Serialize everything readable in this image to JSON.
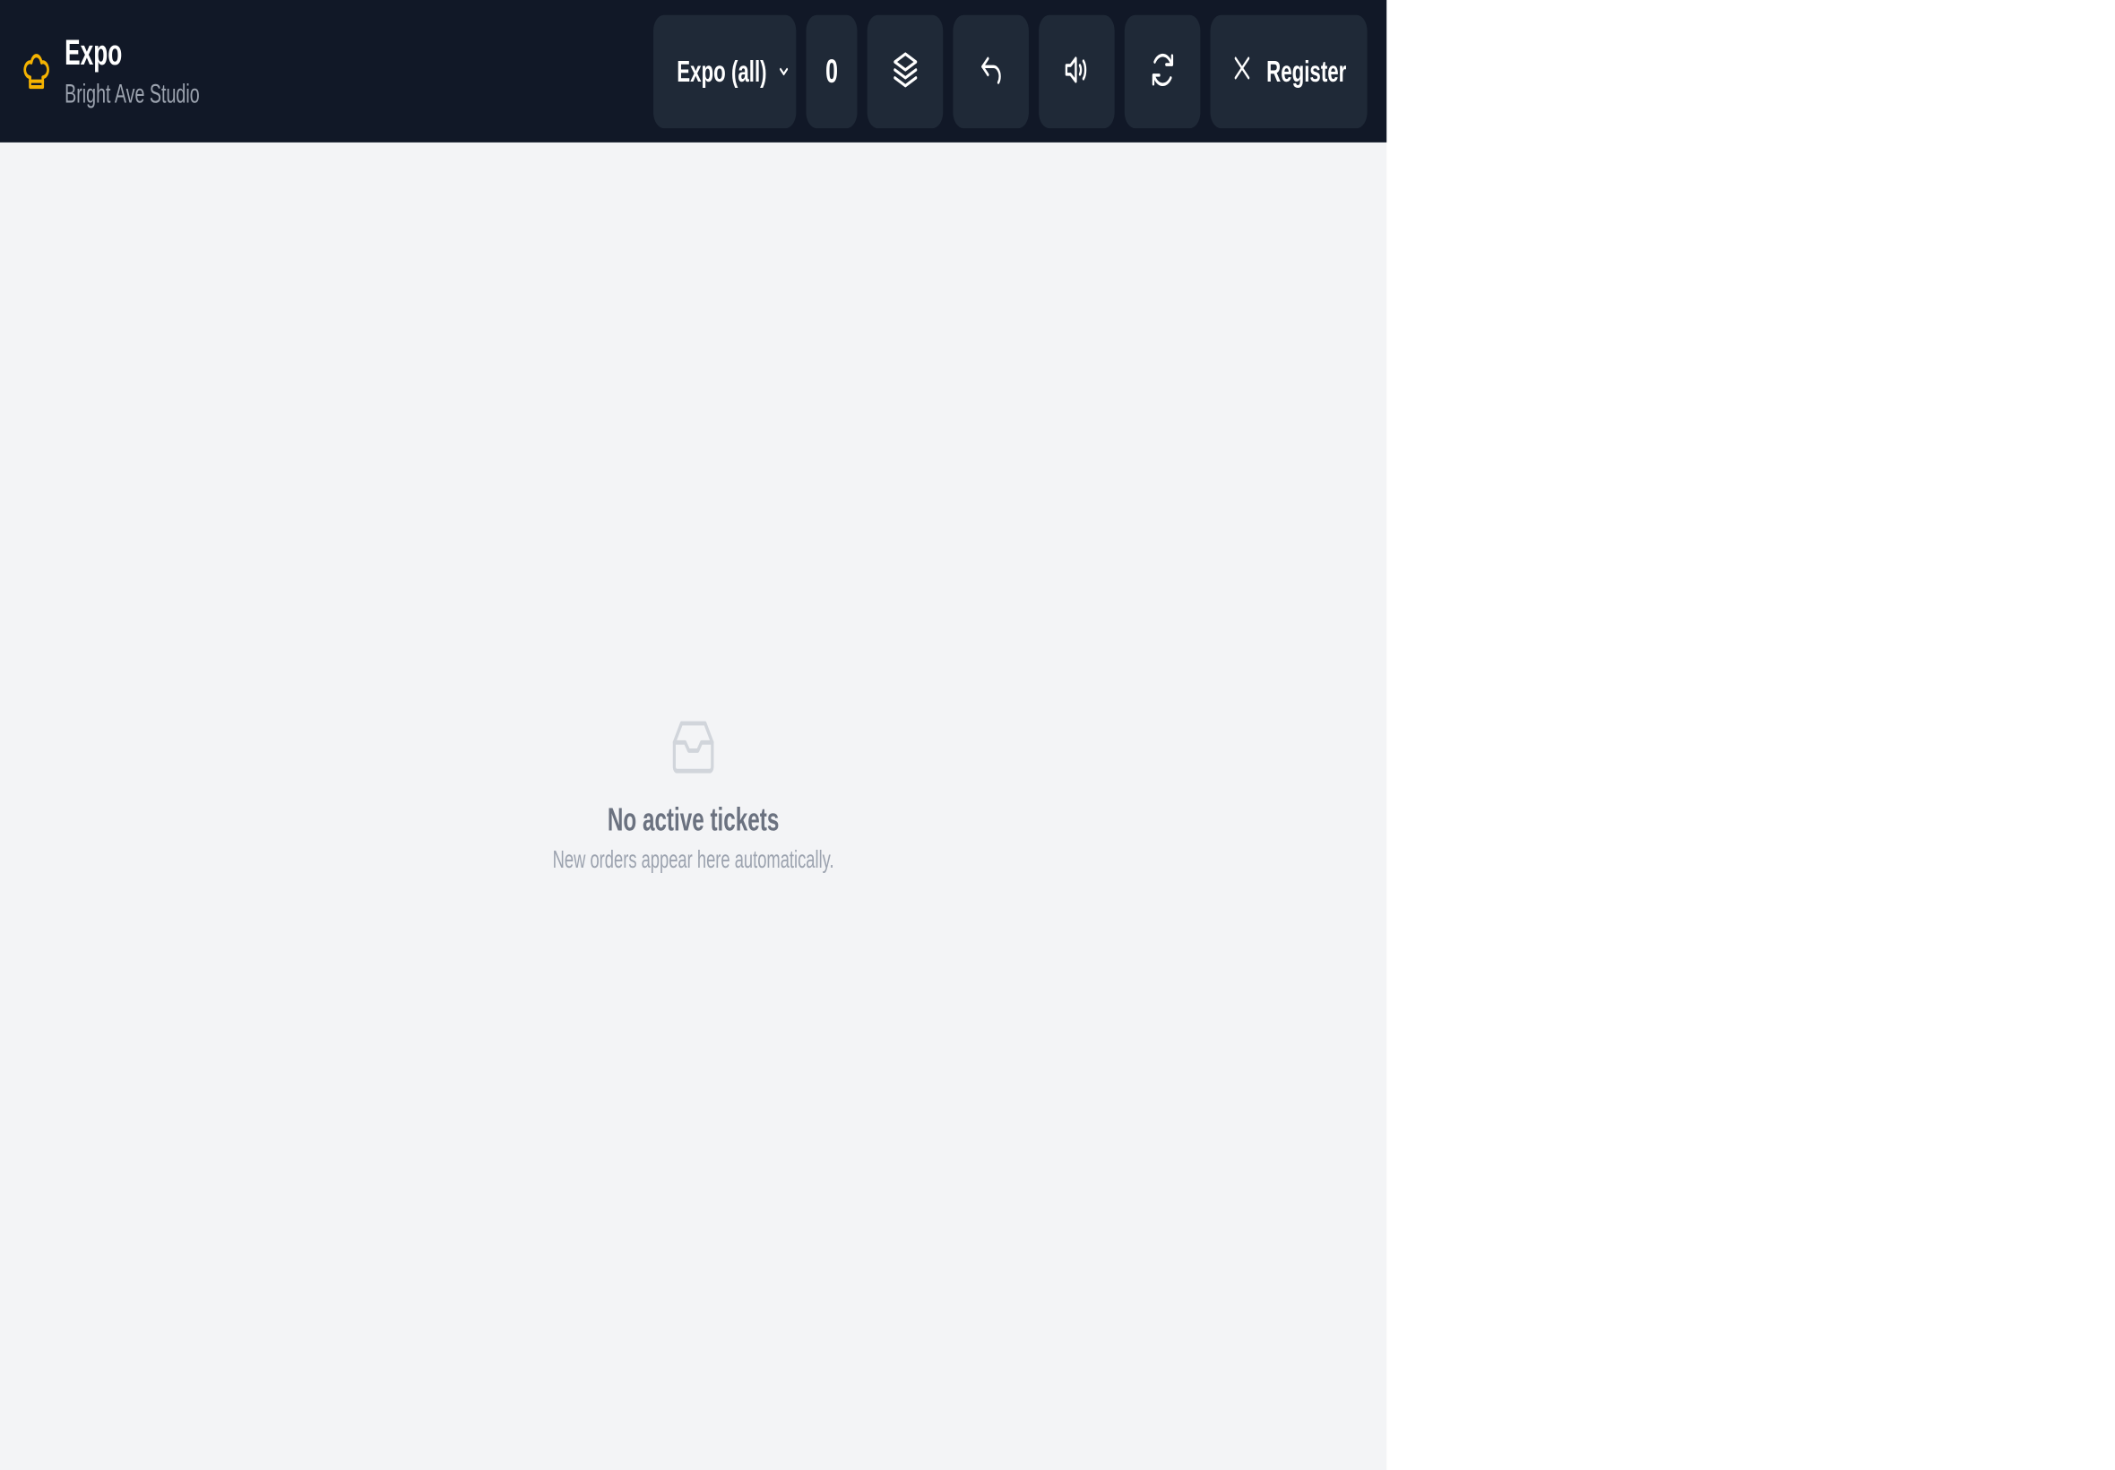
{
  "header": {
    "title": "Expo",
    "subtitle": "Bright Ave Studio",
    "logo_icon": "chef-hat-icon",
    "accent_color": "#f5b301"
  },
  "toolbar": {
    "station_select": {
      "value": "Expo (all)"
    },
    "ticket_count": "0",
    "buttons": [
      {
        "icon": "layers-icon"
      },
      {
        "icon": "undo-icon"
      },
      {
        "icon": "volume-icon"
      },
      {
        "icon": "refresh-icon"
      }
    ],
    "register": {
      "icon": "close-icon",
      "label": "Register"
    }
  },
  "empty_state": {
    "icon": "inbox-icon",
    "title": "No active tickets",
    "message": "New orders appear here automatically."
  }
}
